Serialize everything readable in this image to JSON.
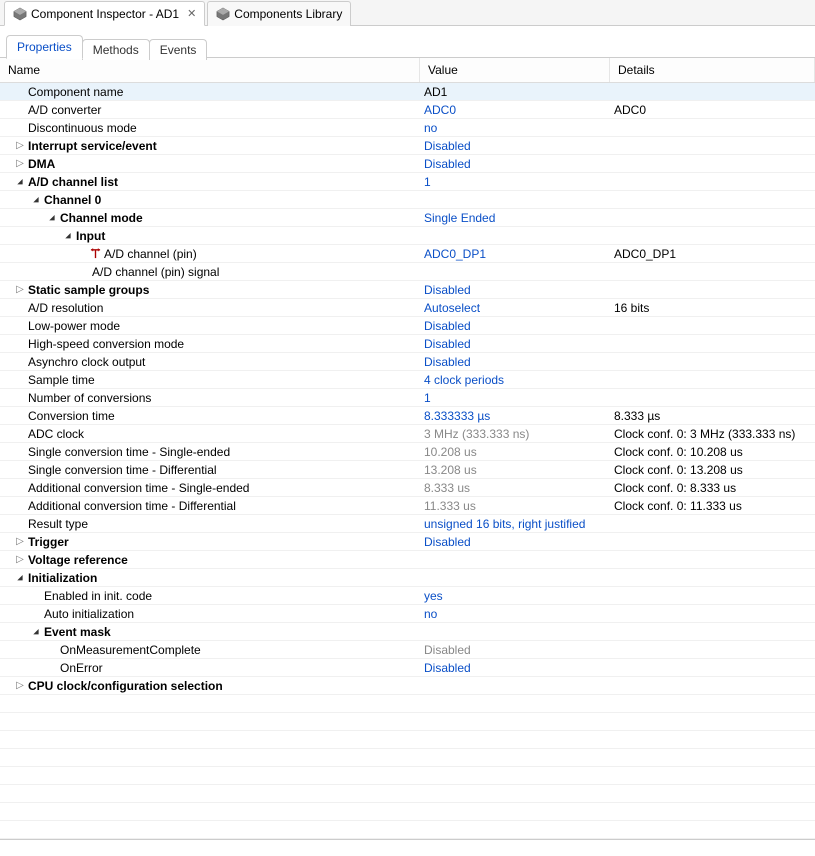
{
  "editorTabs": {
    "active": {
      "label": "Component Inspector - AD1"
    },
    "other": {
      "label": "Components Library"
    }
  },
  "subTabs": {
    "properties": "Properties",
    "methods": "Methods",
    "events": "Events"
  },
  "columns": {
    "name": "Name",
    "value": "Value",
    "details": "Details"
  },
  "rows": [
    {
      "name": "Component name",
      "value": "AD1",
      "details": "",
      "indent": 1,
      "twisty": "",
      "highlight": true,
      "bold": false,
      "vclass": ""
    },
    {
      "name": "A/D converter",
      "value": "ADC0",
      "details": "ADC0",
      "indent": 1,
      "twisty": "",
      "bold": false,
      "vclass": "val-link"
    },
    {
      "name": "Discontinuous mode",
      "value": "no",
      "details": "",
      "indent": 1,
      "twisty": "",
      "bold": false,
      "vclass": "val-link"
    },
    {
      "name": "Interrupt service/event",
      "value": "Disabled",
      "details": "",
      "indent": 1,
      "twisty": "right",
      "bold": true,
      "vclass": "val-link"
    },
    {
      "name": "DMA",
      "value": "Disabled",
      "details": "",
      "indent": 1,
      "twisty": "right",
      "bold": true,
      "vclass": "val-link"
    },
    {
      "name": "A/D channel list",
      "value": "1",
      "details": "",
      "indent": 1,
      "twisty": "down",
      "bold": true,
      "vclass": "val-link"
    },
    {
      "name": "Channel 0",
      "value": "",
      "details": "",
      "indent": 2,
      "twisty": "down",
      "bold": true,
      "vclass": ""
    },
    {
      "name": "Channel mode",
      "value": "Single Ended",
      "details": "",
      "indent": 3,
      "twisty": "down",
      "bold": true,
      "vclass": "val-link"
    },
    {
      "name": "Input",
      "value": "",
      "details": "",
      "indent": 4,
      "twisty": "down",
      "bold": true,
      "vclass": ""
    },
    {
      "name": "A/D channel (pin)",
      "value": "ADC0_DP1",
      "details": "ADC0_DP1",
      "indent": 5,
      "twisty": "",
      "pin": true,
      "bold": false,
      "vclass": "val-link"
    },
    {
      "name": "A/D channel (pin) signal",
      "value": "",
      "details": "",
      "indent": 5,
      "twisty": "",
      "bold": false,
      "vclass": ""
    },
    {
      "name": "Static sample groups",
      "value": "Disabled",
      "details": "",
      "indent": 1,
      "twisty": "right",
      "bold": true,
      "vclass": "val-link"
    },
    {
      "name": "A/D resolution",
      "value": "Autoselect",
      "details": "16 bits",
      "indent": 1,
      "twisty": "",
      "bold": false,
      "vclass": "val-link"
    },
    {
      "name": "Low-power mode",
      "value": "Disabled",
      "details": "",
      "indent": 1,
      "twisty": "",
      "bold": false,
      "vclass": "val-link"
    },
    {
      "name": "High-speed conversion mode",
      "value": "Disabled",
      "details": "",
      "indent": 1,
      "twisty": "",
      "bold": false,
      "vclass": "val-link"
    },
    {
      "name": "Asynchro clock output",
      "value": "Disabled",
      "details": "",
      "indent": 1,
      "twisty": "",
      "bold": false,
      "vclass": "val-link"
    },
    {
      "name": "Sample time",
      "value": "4 clock periods",
      "details": "",
      "indent": 1,
      "twisty": "",
      "bold": false,
      "vclass": "val-link"
    },
    {
      "name": "Number of conversions",
      "value": "1",
      "details": "",
      "indent": 1,
      "twisty": "",
      "bold": false,
      "vclass": "val-link"
    },
    {
      "name": "Conversion time",
      "value": "8.333333 µs",
      "details": "8.333 µs",
      "indent": 1,
      "twisty": "",
      "bold": false,
      "vclass": "val-link"
    },
    {
      "name": "ADC clock",
      "value": "3 MHz (333.333 ns)",
      "details": "Clock conf. 0: 3 MHz (333.333 ns)",
      "indent": 1,
      "twisty": "",
      "bold": false,
      "vclass": "val-grey"
    },
    {
      "name": "Single conversion time - Single-ended",
      "value": "10.208 us",
      "details": "Clock conf. 0: 10.208 us",
      "indent": 1,
      "twisty": "",
      "bold": false,
      "vclass": "val-grey"
    },
    {
      "name": "Single conversion time - Differential",
      "value": "13.208 us",
      "details": "Clock conf. 0: 13.208 us",
      "indent": 1,
      "twisty": "",
      "bold": false,
      "vclass": "val-grey"
    },
    {
      "name": "Additional conversion time - Single-ended",
      "value": "8.333 us",
      "details": "Clock conf. 0: 8.333 us",
      "indent": 1,
      "twisty": "",
      "bold": false,
      "vclass": "val-grey"
    },
    {
      "name": "Additional conversion time - Differential",
      "value": "11.333 us",
      "details": "Clock conf. 0: 11.333 us",
      "indent": 1,
      "twisty": "",
      "bold": false,
      "vclass": "val-grey"
    },
    {
      "name": "Result type",
      "value": "unsigned 16 bits, right justified",
      "details": "",
      "indent": 1,
      "twisty": "",
      "bold": false,
      "vclass": "val-link"
    },
    {
      "name": "Trigger",
      "value": "Disabled",
      "details": "",
      "indent": 1,
      "twisty": "right",
      "bold": true,
      "vclass": "val-link"
    },
    {
      "name": "Voltage reference",
      "value": "",
      "details": "",
      "indent": 1,
      "twisty": "right",
      "bold": true,
      "vclass": ""
    },
    {
      "name": "Initialization",
      "value": "",
      "details": "",
      "indent": 1,
      "twisty": "down",
      "bold": true,
      "vclass": ""
    },
    {
      "name": "Enabled in init. code",
      "value": "yes",
      "details": "",
      "indent": 2,
      "twisty": "",
      "bold": false,
      "vclass": "val-link"
    },
    {
      "name": "Auto initialization",
      "value": "no",
      "details": "",
      "indent": 2,
      "twisty": "",
      "bold": false,
      "vclass": "val-link"
    },
    {
      "name": "Event mask",
      "value": "",
      "details": "",
      "indent": 2,
      "twisty": "down",
      "bold": true,
      "vclass": ""
    },
    {
      "name": "OnMeasurementComplete",
      "value": "Disabled",
      "details": "",
      "indent": 3,
      "twisty": "",
      "bold": false,
      "vclass": "val-grey"
    },
    {
      "name": "OnError",
      "value": "Disabled",
      "details": "",
      "indent": 3,
      "twisty": "",
      "bold": false,
      "vclass": "val-link"
    },
    {
      "name": "CPU clock/configuration selection",
      "value": "",
      "details": "",
      "indent": 1,
      "twisty": "right",
      "bold": true,
      "vclass": ""
    }
  ],
  "emptyRows": 8
}
